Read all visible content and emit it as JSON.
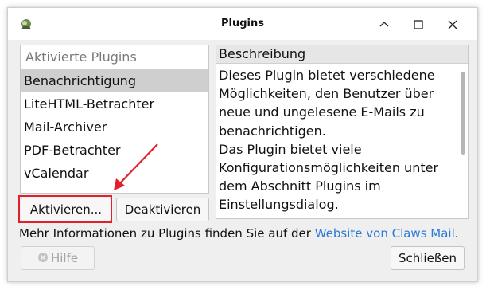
{
  "window": {
    "title": "Plugins",
    "controls": {
      "minimize": "minimize-icon",
      "maximize": "maximize-icon",
      "close": "close-icon"
    }
  },
  "plugin_list": {
    "header": "Aktivierte Plugins",
    "items": [
      {
        "label": "Benachrichtigung",
        "selected": true
      },
      {
        "label": "LiteHTML-Betrachter",
        "selected": false
      },
      {
        "label": "Mail-Archiver",
        "selected": false
      },
      {
        "label": "PDF-Betrachter",
        "selected": false
      },
      {
        "label": "vCalendar",
        "selected": false
      }
    ]
  },
  "description": {
    "header": "Beschreibung",
    "lines": [
      "Dieses Plugin bietet verschiedene",
      "Möglichkeiten, den Benutzer über",
      "neue und ungelesene E-Mails zu",
      "benachrichtigen.",
      "Das Plugin bietet viele",
      "Konfigurationsmöglichkeiten unter",
      "dem Abschnitt Plugins im",
      "Einstellungsdialog."
    ]
  },
  "buttons": {
    "activate": "Aktivieren...",
    "deactivate": "Deaktivieren",
    "help": "Hilfe",
    "close": "Schließen"
  },
  "info": {
    "text": "Mehr Informationen zu Plugins finden Sie auf der ",
    "link": "Website von Claws Mail",
    "suffix": "."
  },
  "colors": {
    "highlight": "#e0202a",
    "link": "#2a7bd5",
    "selected_row": "#cfcfcf"
  }
}
